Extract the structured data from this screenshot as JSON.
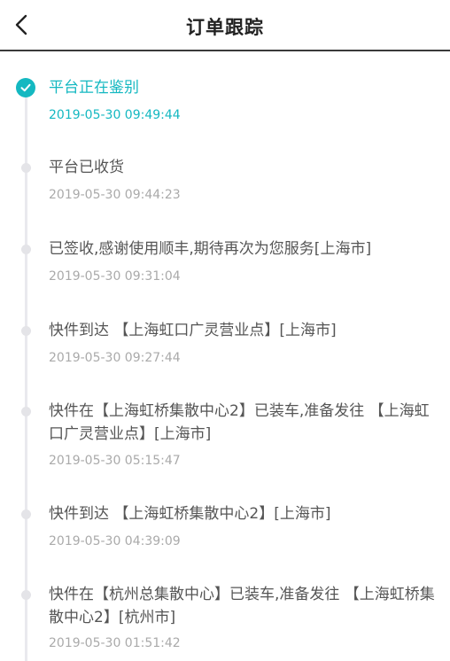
{
  "header": {
    "title": "订单跟踪",
    "back_icon": "chevron-left-icon"
  },
  "colors": {
    "accent": "#14b8c1",
    "text": "#555555",
    "muted": "#aaaaaa",
    "track": "#e9e9ee"
  },
  "timeline": {
    "events": [
      {
        "text": "平台正在鉴别",
        "time": "2019-05-30 09:49:44",
        "active": true
      },
      {
        "text": "平台已收货",
        "time": "2019-05-30 09:44:23",
        "active": false
      },
      {
        "text": "已签收,感谢使用顺丰,期待再次为您服务[上海市]",
        "time": "2019-05-30 09:31:04",
        "active": false
      },
      {
        "text": "快件到达 【上海虹口广灵营业点】[上海市]",
        "time": "2019-05-30 09:27:44",
        "active": false
      },
      {
        "text": "快件在【上海虹桥集散中心2】已装车,准备发往 【上海虹口广灵营业点】[上海市]",
        "time": "2019-05-30 05:15:47",
        "active": false
      },
      {
        "text": "快件到达 【上海虹桥集散中心2】[上海市]",
        "time": "2019-05-30 04:39:09",
        "active": false
      },
      {
        "text": "快件在【杭州总集散中心】已装车,准备发往 【上海虹桥集散中心2】[杭州市]",
        "time": "2019-05-30 01:51:42",
        "active": false
      }
    ]
  }
}
